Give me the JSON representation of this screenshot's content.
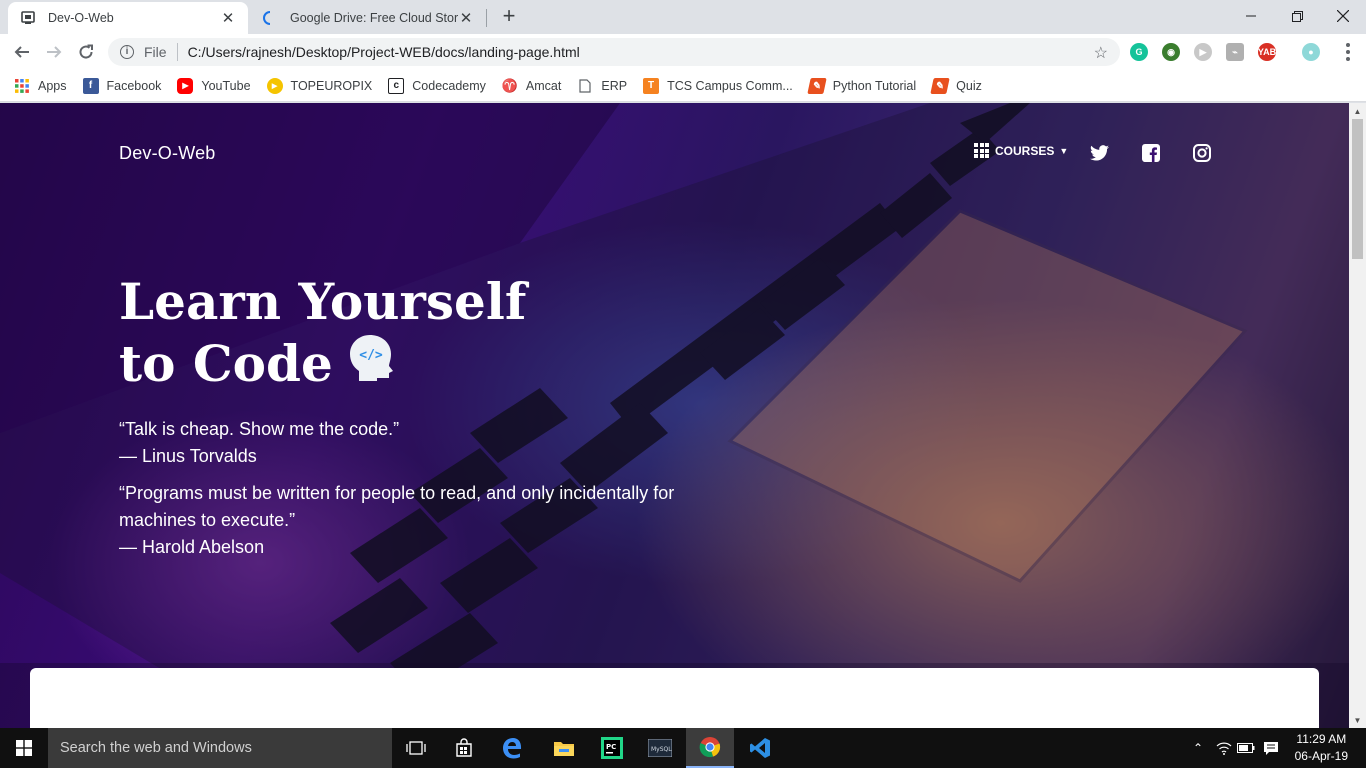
{
  "browser": {
    "tabs": [
      {
        "title": "Dev-O-Web",
        "active": true,
        "icon": "page-icon"
      },
      {
        "title": "Google Drive: Free Cloud Storage",
        "active": false,
        "icon": "loading-icon"
      }
    ],
    "address": {
      "scheme_label": "File",
      "url": "C:/Users/rajnesh/Desktop/Project-WEB/docs/landing-page.html"
    },
    "bookmarks": [
      {
        "label": "Apps",
        "icon": "apps-grid-icon"
      },
      {
        "label": "Facebook",
        "icon": "facebook-icon",
        "color": "#3b5998"
      },
      {
        "label": "YouTube",
        "icon": "youtube-icon",
        "color": "#ff0000"
      },
      {
        "label": "TOPEUROPIX",
        "icon": "play-circle-icon",
        "color": "#f5c400"
      },
      {
        "label": "Codecademy",
        "icon": "codecademy-icon"
      },
      {
        "label": "Amcat",
        "icon": "amcat-icon",
        "color": "#d9302c"
      },
      {
        "label": "ERP",
        "icon": "document-icon"
      },
      {
        "label": "TCS Campus Comm...",
        "icon": "tcs-icon",
        "color": "#f58220"
      },
      {
        "label": "Python Tutorial",
        "icon": "python-tutorial-icon",
        "color": "#e8501e"
      },
      {
        "label": "Quiz",
        "icon": "quiz-icon",
        "color": "#e8501e"
      }
    ]
  },
  "site": {
    "brand": "Dev-O-Web",
    "nav": {
      "courses_label": "COURSES"
    },
    "headline": {
      "line1": "Learn Yourself",
      "line2": "to Code"
    },
    "quotes": [
      {
        "text": "“Talk is cheap. Show me the code.”",
        "author": "— Linus Torvalds"
      },
      {
        "text": "“Programs must be written for people to read, and only incidentally for machines to execute.”",
        "author": "— Harold Abelson"
      }
    ]
  },
  "taskbar": {
    "search_placeholder": "Search the web and Windows",
    "time": "11:29 AM",
    "date": "06-Apr-19"
  },
  "colors": {
    "hero_purple": "#3a0c78",
    "accent_blue": "#8ab4f8"
  }
}
